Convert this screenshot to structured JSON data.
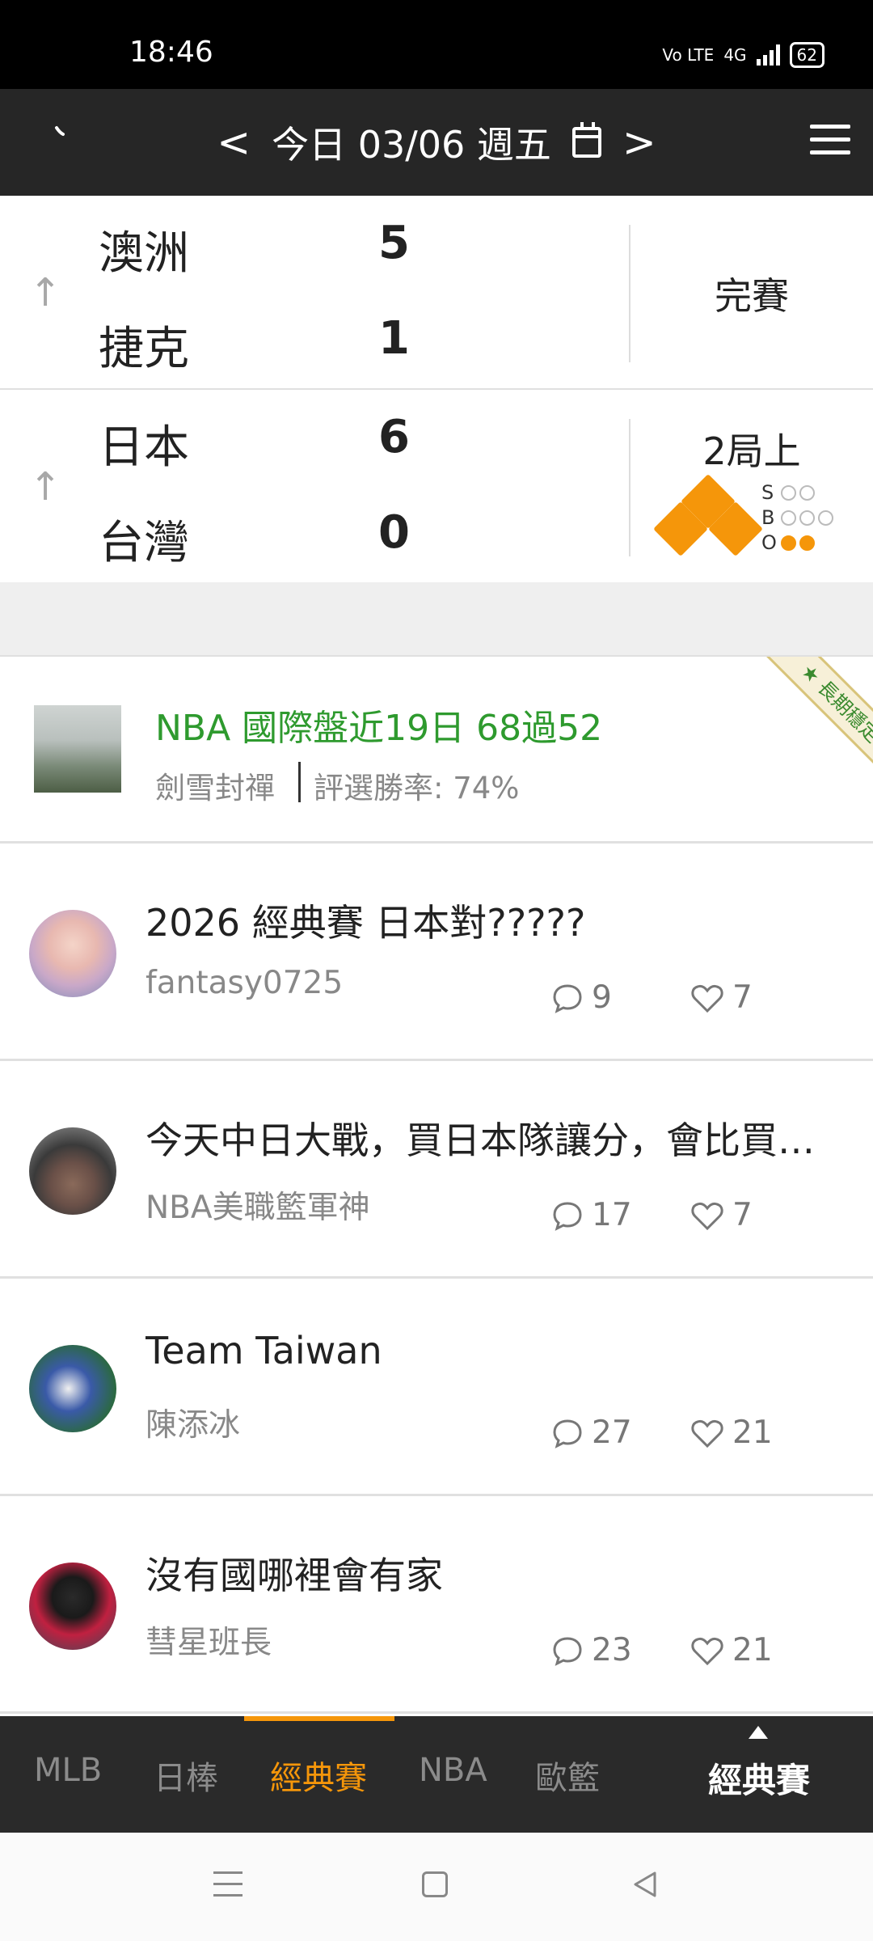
{
  "status_bar": {
    "time": "18:46",
    "network": "4G",
    "volte": "Vo LTE",
    "battery": "62"
  },
  "header": {
    "prev": "<",
    "date": "今日 03/06 週五",
    "next": ">"
  },
  "games": [
    {
      "team1": "澳洲",
      "score1": "5",
      "team2": "捷克",
      "score2": "1",
      "state": "完賽"
    },
    {
      "team1": "日本",
      "score1": "6",
      "team2": "台灣",
      "score2": "0",
      "state": "2局上",
      "bso": {
        "strikes": 0,
        "balls": 0,
        "outs": 2,
        "labels": [
          "S",
          "B",
          "O"
        ]
      },
      "bases": {
        "first": true,
        "second": true,
        "third": true
      }
    }
  ],
  "promo": {
    "title": "NBA 國際盤近19日 68過52",
    "author": "劍雪封禪",
    "rate": "評選勝率: 74%",
    "ribbon": "長期穩定",
    "title_color": "#2e9a2e"
  },
  "posts": [
    {
      "title": "2026 經典賽 日本對?????",
      "author": "fantasy0725",
      "comments": "9",
      "likes": "7"
    },
    {
      "title": "今天中日大戰，買日本隊讓分，會比買…",
      "author": "NBA美職籃軍神",
      "comments": "17",
      "likes": "7"
    },
    {
      "title": "Team Taiwan",
      "author": "陳添冰",
      "comments": "27",
      "likes": "21"
    },
    {
      "title": "沒有國哪裡會有家",
      "author": "彗星班長",
      "comments": "23",
      "likes": "21"
    }
  ],
  "tabs": {
    "items": [
      "MLB",
      "日棒",
      "經典賽",
      "NBA",
      "歐籃"
    ],
    "active": "經典賽",
    "current": "經典賽",
    "accent": "#f5960a"
  }
}
